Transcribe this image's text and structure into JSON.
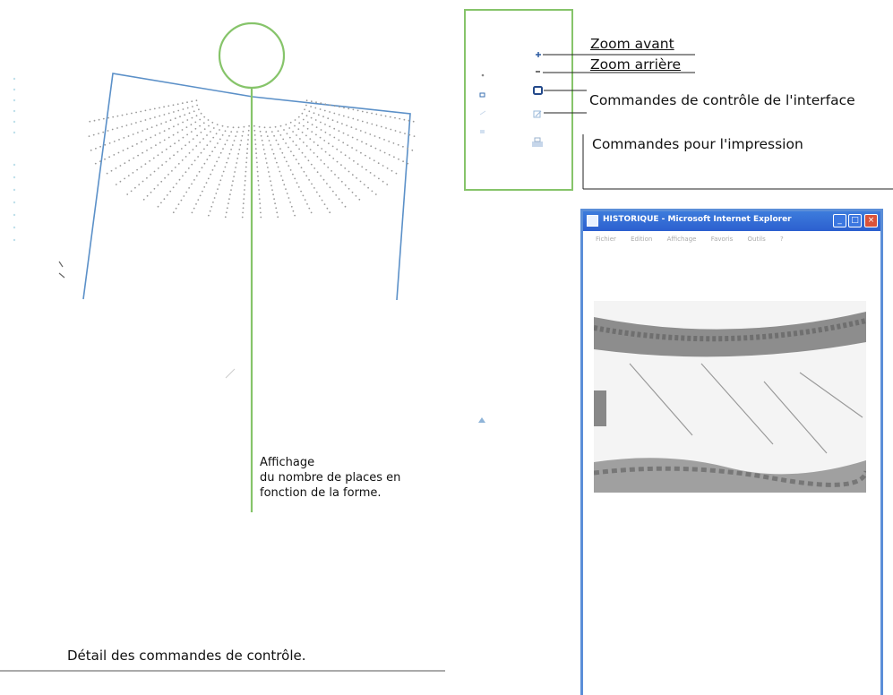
{
  "annotation": {
    "line1": "Affichage",
    "line2": "du nombre de places en",
    "line3": "fonction de la forme."
  },
  "caption": "Détail des commandes de contrôle.",
  "controls": {
    "zoom_in_label": "Zoom avant",
    "zoom_out_label": "Zoom arrière",
    "interface_label": "Commandes de contrôle de l'interface",
    "print_label": "Commandes pour l'impression",
    "icons": [
      "plus-icon",
      "minus-icon",
      "square-icon",
      "arrow-icon",
      "printer-icon"
    ]
  },
  "browser": {
    "title": "HISTORIQUE - Microsoft Internet Explorer",
    "menu": [
      "Fichier",
      "Edition",
      "Affichage",
      "Favoris",
      "Outils",
      "?"
    ],
    "window_buttons": [
      "_",
      "□",
      "×"
    ]
  },
  "colors": {
    "green_accent": "#86c46a",
    "blue_outline": "#5b90c8",
    "ie_titlebar": "#2f64d2",
    "close_button": "#d9533b"
  }
}
